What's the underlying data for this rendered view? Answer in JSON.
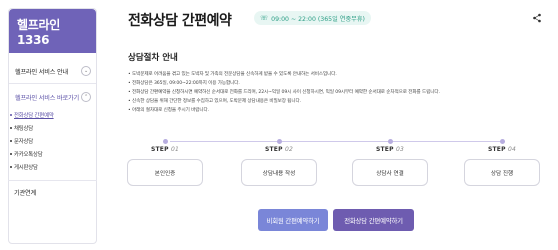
{
  "sidebar": {
    "brand": "헬프라인 1336",
    "menu": [
      {
        "label": "헬프라인 서비스 안내",
        "chevron": "⌄"
      },
      {
        "label": "헬프라인 서비스 바로가기",
        "chevron": "⌃"
      }
    ],
    "sub_items": [
      {
        "label": "전화상담 간편예약",
        "selected": true
      },
      {
        "label": "채팅상담",
        "selected": false
      },
      {
        "label": "문자상담",
        "selected": false
      },
      {
        "label": "카카오톡상담",
        "selected": false
      },
      {
        "label": "게시판상담",
        "selected": false
      }
    ],
    "footer_item": "기관연계"
  },
  "header": {
    "title": "전화상담 간편예약",
    "hours": "09:00 ~ 22:00 (365일 연중무휴)",
    "hours_icon": "phone-icon",
    "share_icon": "share-icon"
  },
  "guide": {
    "title": "상담절차 안내",
    "notices": [
      "도박문제로 어려움을 겪고 있는 도박자 및 가족의 전문상담을 신속하게 받을 수 있도록 안내하는 서비스입니다.",
      "전화상담은 365일, 09:00~22:00까지 이용 가능합니다.",
      "전화상담 간편예약을 신청하시면 예약하신 순서대로 전화를 드리며, 22시~익일 09시 사이 신청하시면, 익일 09시부터 예약한 순서대로 순차적으로 전화를 드립니다.",
      "신속한 상담을 위해 간단한 정보를 수집하고 있으며, 도박문제 상담내용은 비밀보장 됩니다.",
      "아래의 절차대로 신청을 주시기 바랍니다."
    ]
  },
  "steps": [
    {
      "label": "STEP",
      "num": "01",
      "box": "본인인증"
    },
    {
      "label": "STEP",
      "num": "02",
      "box": "상담내용 작성"
    },
    {
      "label": "STEP",
      "num": "03",
      "box": "상담사 연결"
    },
    {
      "label": "STEP",
      "num": "04",
      "box": "상담 진행"
    }
  ],
  "buttons": {
    "video": "비회원 간편예약하기",
    "phone": "전화상담 간편예약하기"
  },
  "colors": {
    "brand": "#6f63b8",
    "accent_teal": "#2a9d84",
    "button_blue": "#7a86d8",
    "button_purple": "#6e5cb0"
  }
}
